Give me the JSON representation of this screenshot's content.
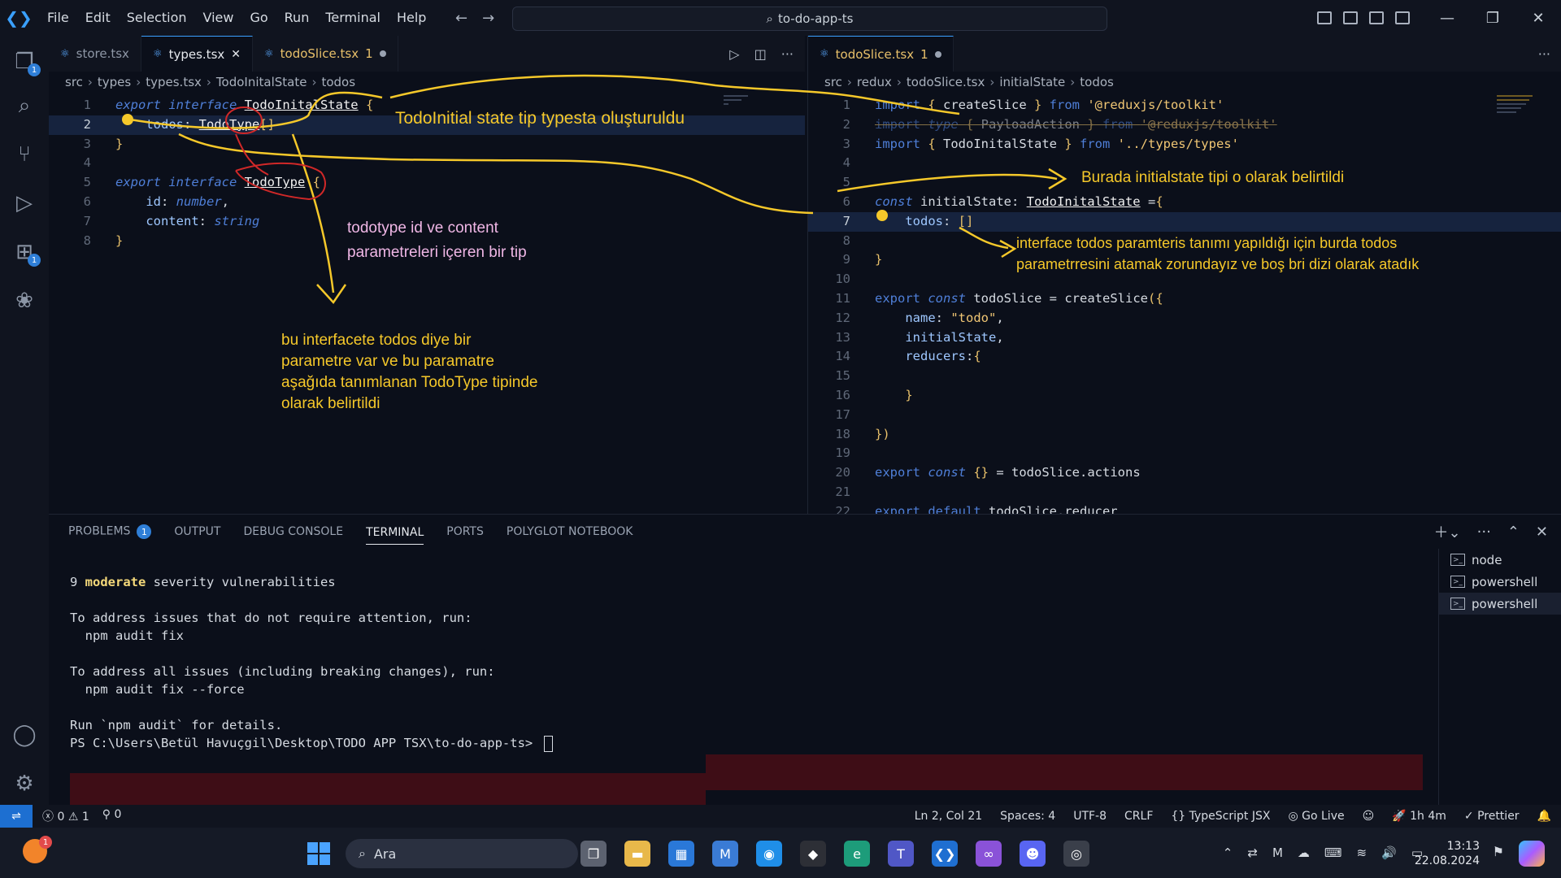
{
  "menu": [
    "File",
    "Edit",
    "Selection",
    "View",
    "Go",
    "Run",
    "Terminal",
    "Help"
  ],
  "search_title": "to-do-app-ts",
  "activity_badges": {
    "explorer": "1",
    "extensions": "1"
  },
  "left_editor": {
    "tabs": [
      {
        "label": "store.tsx"
      },
      {
        "label": "types.tsx"
      },
      {
        "label": "todoSlice.tsx",
        "suffix": "1"
      }
    ],
    "breadcrumb": [
      "src",
      "types",
      "types.tsx",
      "TodoInitalState",
      "todos"
    ],
    "lines": [
      {
        "n": "1",
        "tokens": [
          [
            "kw",
            "export "
          ],
          [
            "kw",
            "interface "
          ],
          [
            "ty",
            "TodoInitalState"
          ],
          [
            "punc",
            " {"
          ]
        ]
      },
      {
        "n": "2",
        "tokens": [
          [
            "prop",
            "    todos"
          ],
          [
            "plain",
            ": "
          ],
          [
            "ty",
            "TodoType"
          ],
          [
            "punc",
            "[]"
          ]
        ]
      },
      {
        "n": "3",
        "tokens": [
          [
            "punc",
            "}"
          ]
        ]
      },
      {
        "n": "4",
        "tokens": []
      },
      {
        "n": "5",
        "tokens": [
          [
            "kw",
            "export "
          ],
          [
            "kw",
            "interface "
          ],
          [
            "ty",
            "TodoType"
          ],
          [
            "punc",
            " {"
          ]
        ]
      },
      {
        "n": "6",
        "tokens": [
          [
            "prop",
            "    id"
          ],
          [
            "plain",
            ": "
          ],
          [
            "kw",
            "number"
          ],
          [
            "plain",
            ","
          ]
        ]
      },
      {
        "n": "7",
        "tokens": [
          [
            "prop",
            "    content"
          ],
          [
            "plain",
            ": "
          ],
          [
            "kw",
            "string"
          ]
        ]
      },
      {
        "n": "8",
        "tokens": [
          [
            "punc",
            "}"
          ]
        ]
      }
    ]
  },
  "right_editor": {
    "tabs": [
      {
        "label": "todoSlice.tsx",
        "suffix": "1"
      }
    ],
    "breadcrumb": [
      "src",
      "redux",
      "todoSlice.tsx",
      "initialState",
      "todos"
    ],
    "lines": [
      {
        "n": "1",
        "tokens": [
          [
            "kwn",
            "import "
          ],
          [
            "punc",
            "{ "
          ],
          [
            "plain",
            "createSlice"
          ],
          [
            "punc",
            " } "
          ],
          [
            "kwn",
            "from "
          ],
          [
            "str",
            "'@reduxjs/toolkit'"
          ]
        ]
      },
      {
        "n": "2",
        "strike": true,
        "tokens": [
          [
            "kwn",
            "import "
          ],
          [
            "kw",
            "type "
          ],
          [
            "punc",
            "{ "
          ],
          [
            "plain",
            "PayloadAction"
          ],
          [
            "punc",
            " } "
          ],
          [
            "kwn",
            "from "
          ],
          [
            "str",
            "'@reduxjs/toolkit'"
          ]
        ]
      },
      {
        "n": "3",
        "tokens": [
          [
            "kwn",
            "import "
          ],
          [
            "punc",
            "{ "
          ],
          [
            "plain",
            "TodoInitalState"
          ],
          [
            "punc",
            " } "
          ],
          [
            "kwn",
            "from "
          ],
          [
            "str",
            "'../types/types'"
          ]
        ]
      },
      {
        "n": "4",
        "tokens": []
      },
      {
        "n": "5",
        "tokens": []
      },
      {
        "n": "6",
        "tokens": [
          [
            "kw",
            "const "
          ],
          [
            "plain",
            "initialState"
          ],
          [
            "plain",
            ": "
          ],
          [
            "ty",
            "TodoInitalState"
          ],
          [
            "plain",
            " ="
          ],
          [
            "punc",
            "{"
          ]
        ]
      },
      {
        "n": "7",
        "tokens": [
          [
            "prop",
            "    todos"
          ],
          [
            "plain",
            ": "
          ],
          [
            "punc",
            "[]"
          ]
        ]
      },
      {
        "n": "8",
        "tokens": []
      },
      {
        "n": "9",
        "tokens": [
          [
            "punc",
            "}"
          ]
        ]
      },
      {
        "n": "10",
        "tokens": []
      },
      {
        "n": "11",
        "tokens": [
          [
            "kwn",
            "export "
          ],
          [
            "kw",
            "const "
          ],
          [
            "plain",
            "todoSlice"
          ],
          [
            "plain",
            " = "
          ],
          [
            "plain",
            "createSlice"
          ],
          [
            "punc",
            "({"
          ]
        ]
      },
      {
        "n": "12",
        "tokens": [
          [
            "prop",
            "    name"
          ],
          [
            "plain",
            ": "
          ],
          [
            "str",
            "\"todo\""
          ],
          [
            "plain",
            ","
          ]
        ]
      },
      {
        "n": "13",
        "tokens": [
          [
            "prop",
            "    initialState"
          ],
          [
            "plain",
            ","
          ]
        ]
      },
      {
        "n": "14",
        "tokens": [
          [
            "prop",
            "    reducers"
          ],
          [
            "plain",
            ":"
          ],
          [
            "punc",
            "{"
          ]
        ]
      },
      {
        "n": "15",
        "tokens": []
      },
      {
        "n": "16",
        "tokens": [
          [
            "punc",
            "    }"
          ]
        ]
      },
      {
        "n": "17",
        "tokens": []
      },
      {
        "n": "18",
        "tokens": [
          [
            "punc",
            "})"
          ]
        ]
      },
      {
        "n": "19",
        "tokens": []
      },
      {
        "n": "20",
        "tokens": [
          [
            "kwn",
            "export "
          ],
          [
            "kw",
            "const "
          ],
          [
            "punc",
            "{} "
          ],
          [
            "plain",
            "= "
          ],
          [
            "plain",
            "todoSlice"
          ],
          [
            "plain",
            ".actions"
          ]
        ]
      },
      {
        "n": "21",
        "tokens": []
      },
      {
        "n": "22",
        "tokens": [
          [
            "kwn",
            "export "
          ],
          [
            "kwn",
            "default "
          ],
          [
            "plain",
            "todoSlice.reducer"
          ]
        ]
      }
    ]
  },
  "annotations": {
    "a1": "TodoInitial state tip typesta oluşturuldu",
    "a2_l1": "todotype id ve content",
    "a2_l2": "parametreleri içeren bir tip",
    "a3_l1": "bu interfacete todos diye bir",
    "a3_l2": "parametre var ve bu paramatre",
    "a3_l3": "aşağıda tanımlanan TodoType tipinde",
    "a3_l4": "olarak belirtildi",
    "a4": "Burada initialstate tipi o olarak belirtildi",
    "a5_l1": "interface todos paramteris tanımı yapıldığı için burda todos",
    "a5_l2": "parametrresini atamak zorundayız ve boş bri dizi olarak atadık"
  },
  "panel": {
    "tabs": [
      "PROBLEMS",
      "OUTPUT",
      "DEBUG CONSOLE",
      "TERMINAL",
      "PORTS",
      "POLYGLOT NOTEBOOK"
    ],
    "problems_count": "1",
    "terminal_lines": {
      "l1_pre": "9 ",
      "l1_bold": "moderate",
      "l1_post": " severity vulnerabilities",
      "l2": "To address issues that do not require attention, run:",
      "l3": "  npm audit fix",
      "l4": "To address all issues (including breaking changes), run:",
      "l5": "  npm audit fix --force",
      "l6": "Run `npm audit` for details.",
      "l7": "PS C:\\Users\\Betül Havuçgil\\Desktop\\TODO APP TSX\\to-do-app-ts> "
    },
    "terminals": [
      "node",
      "powershell",
      "powershell"
    ]
  },
  "statusbar": {
    "errors": "0",
    "warnings": "1",
    "ports": "0",
    "position": "Ln 2, Col 21",
    "spaces": "Spaces: 4",
    "encoding": "UTF-8",
    "eol": "CRLF",
    "language": "TypeScript JSX",
    "golive": "Go Live",
    "time": "1h 4m",
    "prettier": "Prettier"
  },
  "taskbar": {
    "search": "Ara",
    "weather_badge": "1",
    "clock_time": "13:13",
    "clock_date": "22.08.2024"
  },
  "colors": {
    "accent": "#3aa0ff",
    "annotation": "#f5c82a",
    "annotation_pink": "#f0b7e6",
    "bg": "#0b0f1a"
  }
}
